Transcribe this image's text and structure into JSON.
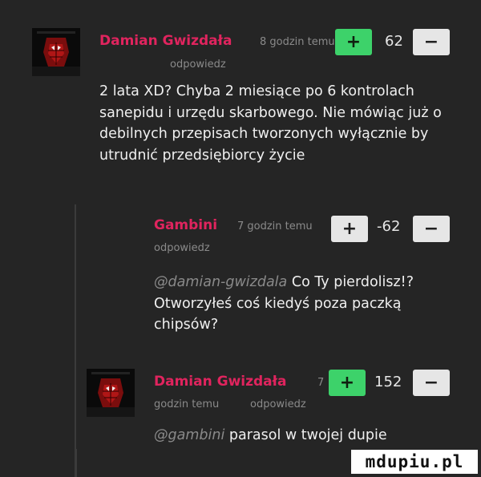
{
  "comments": [
    {
      "author": "Damian Gwizdała",
      "meta": "8 godzin temu",
      "reply": "odpowiedz",
      "score": "62",
      "body": "2 lata XD? Chyba 2 miesiące po 6 kontrolach sanepidu i urzędu skarbowego. Nie mówiąc już o debilnych przepisach tworzonych wyłącznie by utrudnić przedsiębiorcy życie"
    },
    {
      "author": "Gambini",
      "meta": "7 godzin temu",
      "reply": "odpowiedz",
      "score": "-62",
      "mention": "@damian-gwizdala",
      "body": "Co Ty pierdolisz!? Otworzyłeś coś kiedyś poza paczką chipsów?"
    },
    {
      "author": "Damian Gwizdała",
      "meta_a": "7",
      "meta_b": "godzin temu",
      "reply": "odpowiedz",
      "score": "152",
      "mention": "@gambini",
      "body": "parasol w twojej dupie"
    }
  ],
  "buttons": {
    "plus": "+",
    "minus": "−"
  },
  "watermark": "mdupiu.pl",
  "colors": {
    "author": "#e0245e",
    "plus": "#3dd26a",
    "minus": "#e6e6e6",
    "background": "#252525"
  },
  "icons": {
    "avatar": "avatar-spiderman",
    "plus": "plus-icon",
    "minus": "minus-icon"
  }
}
